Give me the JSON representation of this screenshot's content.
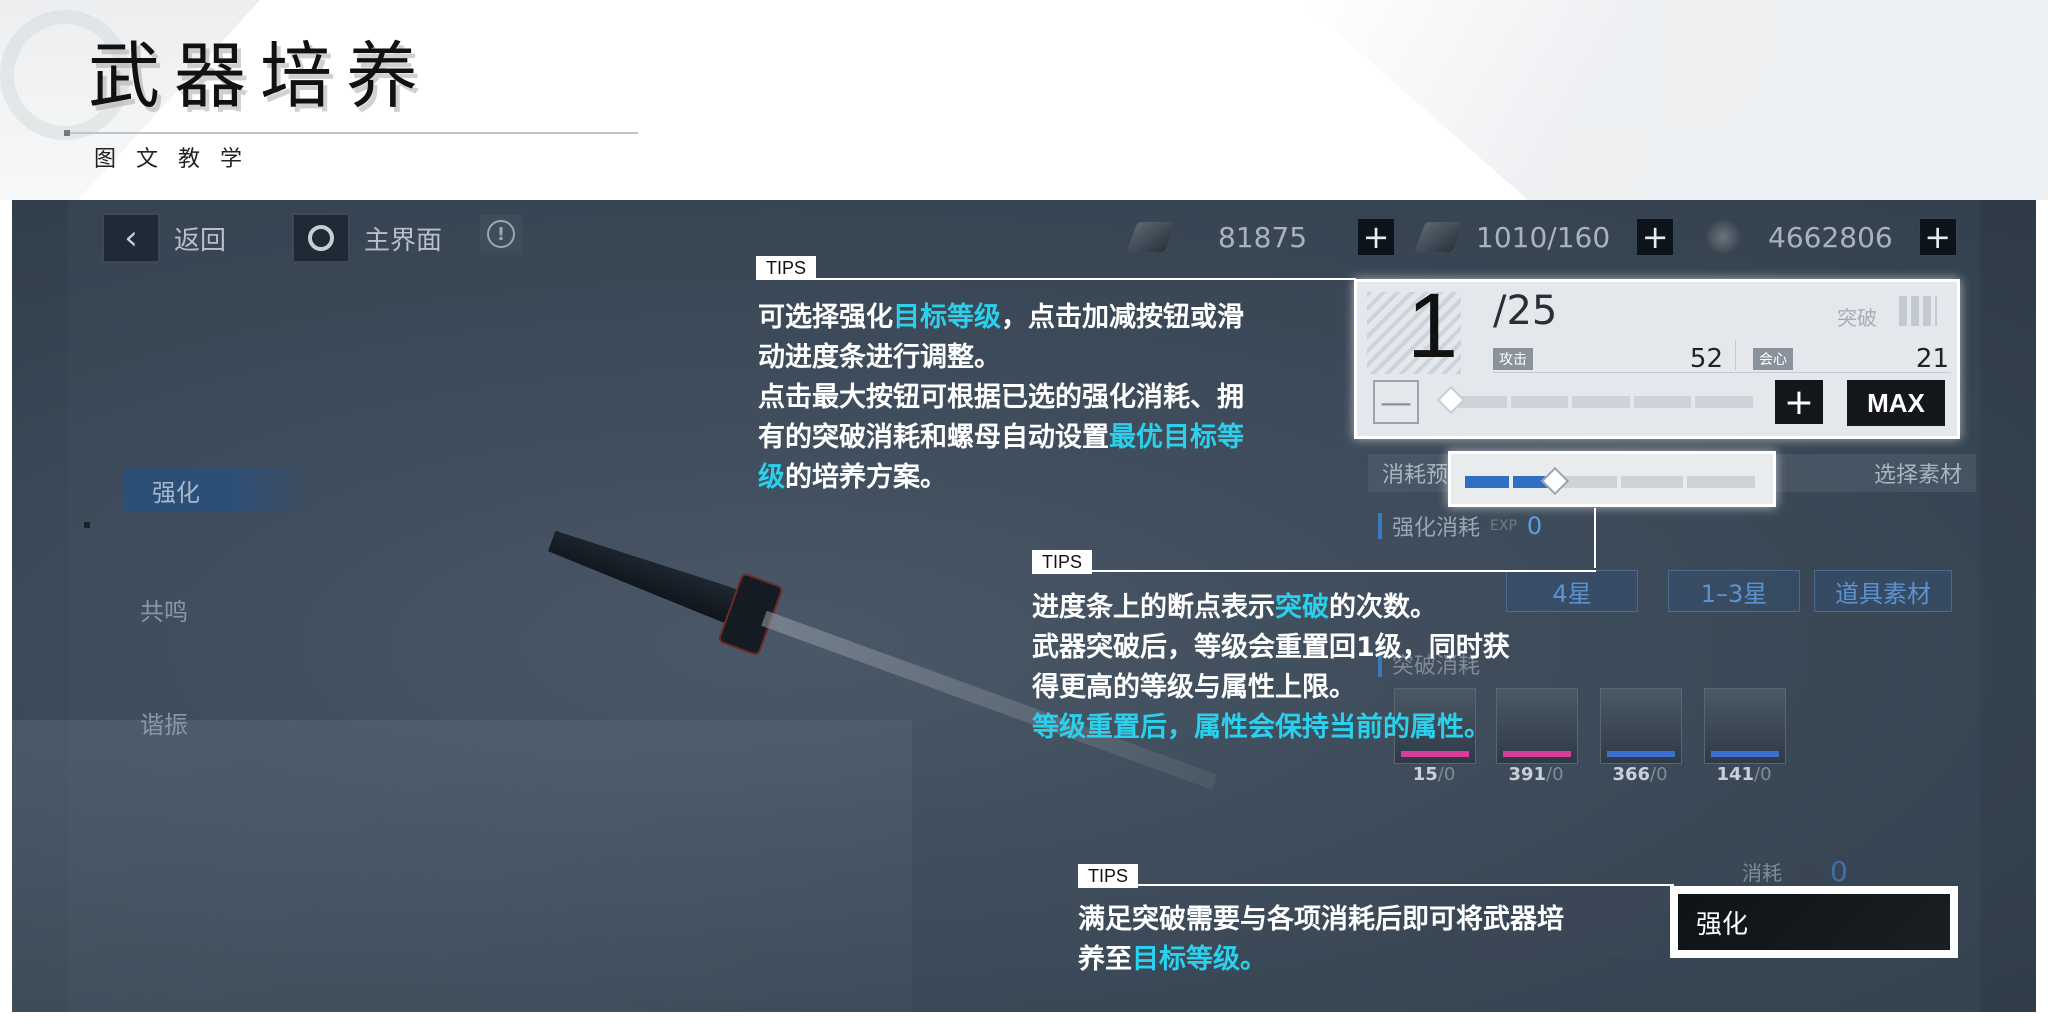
{
  "header": {
    "title": "武器培养",
    "subtitle": "图文教学"
  },
  "topbar": {
    "back_label": "返回",
    "home_label": "主界面",
    "resources": [
      {
        "icon": "material-chip-icon",
        "value": "81875"
      },
      {
        "icon": "stamina-item-icon",
        "value": "1010/160"
      },
      {
        "icon": "shell-credit-icon",
        "value": "4662806"
      }
    ]
  },
  "sidebar": {
    "items": [
      {
        "label": "强化"
      },
      {
        "label": "共鸣"
      },
      {
        "label": "谐振"
      }
    ]
  },
  "level_panel": {
    "current_level": "1",
    "max_level": "/25",
    "breakthrough_label": "突破",
    "stats": [
      {
        "label": "攻击",
        "value": "52"
      },
      {
        "label": "会心",
        "value": "21"
      }
    ],
    "minus": "—",
    "plus": "+",
    "max_button": "MAX",
    "slider_position": 0.0
  },
  "cost_panel": {
    "header_left": "消耗预",
    "header_right": "选择素材",
    "enhance_cost_label": "强化消耗",
    "enhance_cost_unit": "EXP",
    "enhance_cost_value": "0",
    "filters": [
      "4星",
      "1–3星",
      "道具素材"
    ],
    "breakthrough_label": "突破消耗",
    "materials": [
      {
        "count": "15",
        "total": "/0",
        "rarity_color": "#d63c98"
      },
      {
        "count": "391",
        "total": "/0",
        "rarity_color": "#d63c98"
      },
      {
        "count": "366",
        "total": "/0",
        "rarity_color": "#3a6fd0"
      },
      {
        "count": "141",
        "total": "/0",
        "rarity_color": "#3a6fd0"
      }
    ],
    "consume_label": "消耗",
    "consume_value": "0"
  },
  "slider_panel": {
    "progress": 0.3
  },
  "enhance_button": {
    "label": "强化"
  },
  "tips": [
    {
      "tag": "TIPS",
      "lines": [
        [
          {
            "t": "可选择强化"
          },
          {
            "t": "目标等级",
            "hl": true
          },
          {
            "t": "，点击加减按钮或滑"
          }
        ],
        [
          {
            "t": "动进度条进行调整。"
          }
        ],
        [
          {
            "t": "点击最大按钮可根据已选的强化消耗、拥"
          }
        ],
        [
          {
            "t": "有的突破消耗和螺母自动设置"
          },
          {
            "t": "最优目标等",
            "hl": true
          }
        ],
        [
          {
            "t": "级",
            "hl": true
          },
          {
            "t": "的培养方案。"
          }
        ]
      ]
    },
    {
      "tag": "TIPS",
      "lines": [
        [
          {
            "t": "进度条上的断点表示"
          },
          {
            "t": "突破",
            "hl": true
          },
          {
            "t": "的次数。"
          }
        ],
        [
          {
            "t": "武器突破后，等级会重置回1级，同时获"
          }
        ],
        [
          {
            "t": "得更高的等级与属性上限。"
          }
        ],
        [
          {
            "t": "等级重置后，属性会保持当前的属性。",
            "hl": true
          }
        ]
      ]
    },
    {
      "tag": "TIPS",
      "lines": [
        [
          {
            "t": "满足突破需要与各项消耗后即可将武器培"
          }
        ],
        [
          {
            "t": "养至"
          },
          {
            "t": "目标等级。",
            "hl": true
          }
        ]
      ]
    }
  ],
  "colors": {
    "highlight": "#2ad0ec",
    "screen_bg": "#3e4c5c",
    "accent_blue": "#2f6fc4"
  }
}
